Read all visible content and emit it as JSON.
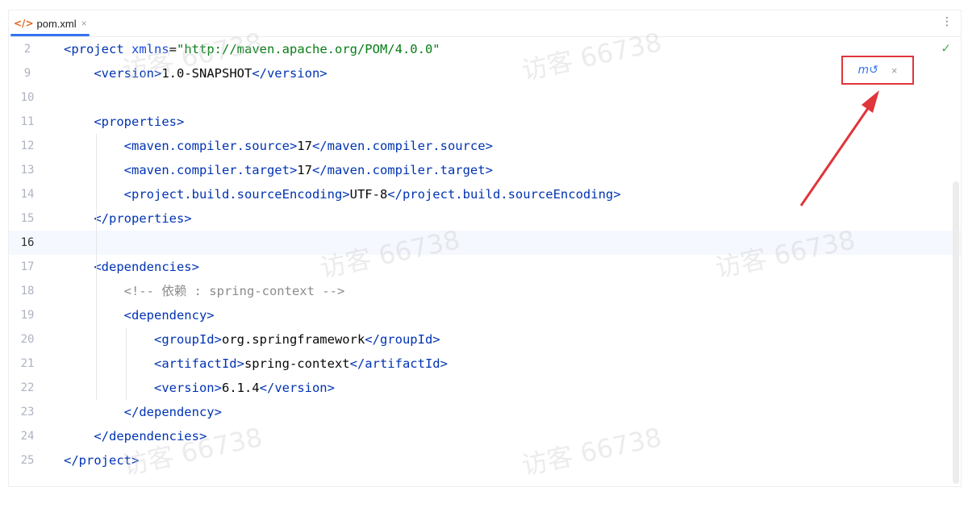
{
  "tab": {
    "icon": "</>",
    "label": "pom.xml",
    "close": "×"
  },
  "toolbar": {
    "more": "⋮",
    "check": "✓"
  },
  "popup": {
    "icon": "m↺",
    "close": "×"
  },
  "watermark": "访客 66738",
  "code_lines": [
    {
      "num": "2",
      "parts": [
        [
          "tag",
          "<project "
        ],
        [
          "attr",
          "xmlns"
        ],
        [
          "plain",
          "="
        ],
        [
          "str",
          "\"http://maven.apache.org/POM/4.0.0\""
        ]
      ]
    },
    {
      "num": "9",
      "parts": [
        [
          "plain",
          "    "
        ],
        [
          "tag",
          "<version>"
        ],
        [
          "plain",
          "1.0-SNAPSHOT"
        ],
        [
          "tag",
          "</version>"
        ]
      ]
    },
    {
      "num": "10",
      "parts": []
    },
    {
      "num": "11",
      "parts": [
        [
          "plain",
          "    "
        ],
        [
          "tag",
          "<properties>"
        ]
      ]
    },
    {
      "num": "12",
      "parts": [
        [
          "plain",
          "        "
        ],
        [
          "tag",
          "<maven.compiler.source>"
        ],
        [
          "plain",
          "17"
        ],
        [
          "tag",
          "</maven.compiler.source>"
        ]
      ]
    },
    {
      "num": "13",
      "parts": [
        [
          "plain",
          "        "
        ],
        [
          "tag",
          "<maven.compiler.target>"
        ],
        [
          "plain",
          "17"
        ],
        [
          "tag",
          "</maven.compiler.target>"
        ]
      ]
    },
    {
      "num": "14",
      "parts": [
        [
          "plain",
          "        "
        ],
        [
          "tag",
          "<project.build.sourceEncoding>"
        ],
        [
          "plain",
          "UTF-8"
        ],
        [
          "tag",
          "</project.build.sourceEncoding>"
        ]
      ]
    },
    {
      "num": "15",
      "parts": [
        [
          "plain",
          "    "
        ],
        [
          "tag",
          "</properties>"
        ]
      ]
    },
    {
      "num": "16",
      "parts": [],
      "current": true
    },
    {
      "num": "17",
      "parts": [
        [
          "plain",
          "    "
        ],
        [
          "tag",
          "<dependencies>"
        ]
      ]
    },
    {
      "num": "18",
      "parts": [
        [
          "plain",
          "        "
        ],
        [
          "comment",
          "<!-- 依赖 : spring-context -->"
        ]
      ]
    },
    {
      "num": "19",
      "parts": [
        [
          "plain",
          "        "
        ],
        [
          "tag",
          "<dependency>"
        ]
      ]
    },
    {
      "num": "20",
      "parts": [
        [
          "plain",
          "            "
        ],
        [
          "tag",
          "<groupId>"
        ],
        [
          "plain",
          "org.springframework"
        ],
        [
          "tag",
          "</groupId>"
        ]
      ]
    },
    {
      "num": "21",
      "parts": [
        [
          "plain",
          "            "
        ],
        [
          "tag",
          "<artifactId>"
        ],
        [
          "plain",
          "spring-context"
        ],
        [
          "tag",
          "</artifactId>"
        ]
      ]
    },
    {
      "num": "22",
      "parts": [
        [
          "plain",
          "            "
        ],
        [
          "tag",
          "<version>"
        ],
        [
          "plain",
          "6.1.4"
        ],
        [
          "tag",
          "</version>"
        ]
      ]
    },
    {
      "num": "23",
      "parts": [
        [
          "plain",
          "        "
        ],
        [
          "tag",
          "</dependency>"
        ]
      ]
    },
    {
      "num": "24",
      "parts": [
        [
          "plain",
          "    "
        ],
        [
          "tag",
          "</dependencies>"
        ]
      ]
    },
    {
      "num": "25",
      "parts": [
        [
          "tag",
          "</project>"
        ]
      ]
    }
  ],
  "colors": {
    "tag": "#0033b3",
    "attr": "#174ad4",
    "string": "#067d17",
    "comment": "#8c8c8c",
    "accent": "#3574f0",
    "highlight": "#e0353b"
  }
}
